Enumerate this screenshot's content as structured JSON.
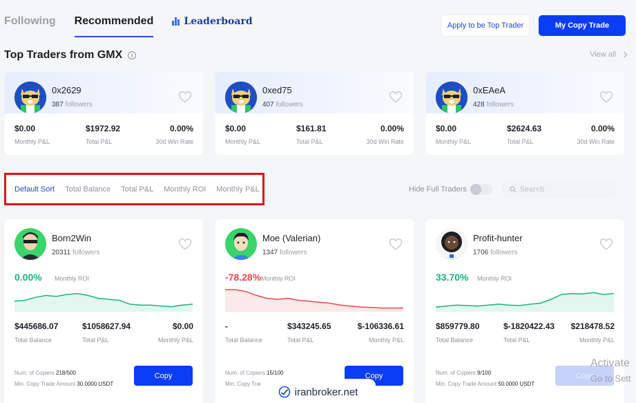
{
  "nav": {
    "tabs": [
      {
        "label": "Following"
      },
      {
        "label": "Recommended"
      },
      {
        "label": "Leaderboard"
      }
    ],
    "apply_button": "Apply to be Top Trader",
    "my_copy_button": "My Copy Trade"
  },
  "section": {
    "title": "Top Traders from GMX",
    "view_all": "View all",
    "info_icon": "i"
  },
  "gmx_traders": [
    {
      "name": "0x2629",
      "followers_count": "387",
      "followers_label": "followers",
      "monthly_pnl": "$0.00",
      "total_pnl": "$1972.92",
      "win_rate": "0.00%",
      "monthly_label": "Monthly P&L",
      "total_label": "Total P&L",
      "win_label": "30d Win Rate"
    },
    {
      "name": "0xed75",
      "followers_count": "407",
      "followers_label": "followers",
      "monthly_pnl": "$0.00",
      "total_pnl": "$161.81",
      "win_rate": "0.00%",
      "monthly_label": "Monthly P&L",
      "total_label": "Total P&L",
      "win_label": "30d Win Rate"
    },
    {
      "name": "0xEAeA",
      "followers_count": "428",
      "followers_label": "followers",
      "monthly_pnl": "$0.00",
      "total_pnl": "$2624.63",
      "win_rate": "0.00%",
      "monthly_label": "Monthly P&L",
      "total_label": "Total P&L",
      "win_label": "30d Win Rate"
    }
  ],
  "sort": {
    "options": [
      "Default Sort",
      "Total Balance",
      "Total P&L",
      "Monthly ROI",
      "Monthly P&L"
    ],
    "active_index": 0,
    "hide_full_label": "Hide Full Traders",
    "hide_full_enabled": false,
    "search_placeholder": "Search"
  },
  "traders": [
    {
      "name": "Born2Win",
      "followers_count": "20311",
      "followers_label": "followers",
      "roi": "0.00%",
      "roi_color": "#19b37a",
      "roi_label": "Monthly ROI",
      "sparkline": [
        0.4,
        0.45,
        0.6,
        0.7,
        0.65,
        0.75,
        0.8,
        0.7,
        0.55,
        0.5,
        0.45,
        0.25,
        0.2,
        0.2,
        0.15,
        0.12,
        0.2,
        0.25
      ],
      "total_balance": "$445686.07",
      "total_pnl": "$1058627.94",
      "monthly_pnl": "$0.00",
      "balance_label": "Total Balance",
      "total_label": "Total P&L",
      "monthly_label": "Monthly P&L",
      "copiers_label": "Num. of Copiers",
      "copiers": "218/500",
      "min_label": "Min. Copy Trade Amount",
      "min_amount": "30.0000 USDT",
      "copy_label": "Copy",
      "copy_enabled": true
    },
    {
      "name": "Moe (Valerian)",
      "followers_count": "1347",
      "followers_label": "followers",
      "roi": "-78.28%",
      "roi_color": "#e5484d",
      "roi_label": "Monthly ROI",
      "sparkline": [
        1.0,
        1.0,
        0.9,
        0.7,
        0.55,
        0.5,
        0.55,
        0.45,
        0.4,
        0.35,
        0.3,
        0.2,
        0.15,
        0.1,
        0.08,
        0.05,
        0.05,
        0.05
      ],
      "total_balance": "-",
      "total_pnl": "$343245.65",
      "monthly_pnl": "$-106336.61",
      "balance_label": "Total Balance",
      "total_label": "Total P&L",
      "monthly_label": "Monthly P&L",
      "copiers_label": "Num. of Copiers",
      "copiers": "15/100",
      "min_label": "Min. Copy Trade",
      "min_amount": "",
      "copy_label": "Copy",
      "copy_enabled": true
    },
    {
      "name": "Profit-hunter",
      "followers_count": "1706",
      "followers_label": "followers",
      "roi": "33.70%",
      "roi_color": "#19b37a",
      "roi_label": "Monthly ROI",
      "sparkline": [
        0.1,
        0.15,
        0.2,
        0.18,
        0.15,
        0.2,
        0.25,
        0.2,
        0.18,
        0.25,
        0.3,
        0.5,
        0.75,
        0.8,
        0.78,
        0.85,
        0.75,
        0.8
      ],
      "total_balance": "$859779.80",
      "total_pnl": "$-1820422.43",
      "monthly_pnl": "$218478.52",
      "balance_label": "Total Balance",
      "total_label": "Total P&L",
      "monthly_label": "Monthly P&L",
      "copiers_label": "Num. of Copiers",
      "copiers": "9/100",
      "min_label": "Min. Copy Trade Amount",
      "min_amount": "50.0000 USDT",
      "copy_label": "Copy",
      "copy_enabled": false
    }
  ],
  "watermark": {
    "text": "iranbroker.net"
  },
  "os_overlay": {
    "line1": "Activate",
    "line2": "Go to Sett"
  }
}
